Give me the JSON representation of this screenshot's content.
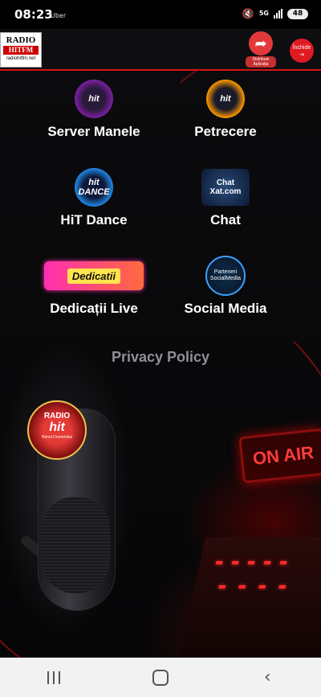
{
  "status": {
    "time": "08:23",
    "carrier": "Uber",
    "network": "5G",
    "battery": "48"
  },
  "header": {
    "logo_top": "RADIO",
    "logo_mid": "HITFM",
    "logo_bottom": "radiohitfm.net",
    "share_label": "Distribuie Aplicația",
    "close_label": "Închide",
    "accent": "#d8121b"
  },
  "tiles": [
    {
      "label": "Server Manele",
      "icon_text": "hit"
    },
    {
      "label": "Petrecere",
      "icon_text": "hit"
    },
    {
      "label": "HiT Dance",
      "icon_text": "hit DANCE"
    },
    {
      "label": "Chat",
      "icon_text_1": "Chat",
      "icon_text_2": "Xat.com"
    },
    {
      "label": "Dedicații Live",
      "icon_text": "Dedicatii"
    },
    {
      "label": "Social Media",
      "icon_text_1": "Parteneri",
      "icon_text_2": "SocialMedia"
    }
  ],
  "privacy": "Privacy Policy",
  "mic_badge": {
    "top": "RADIO",
    "mid": "hit",
    "bottom": "Hanul Drumetului"
  },
  "onair": "ON AIR"
}
